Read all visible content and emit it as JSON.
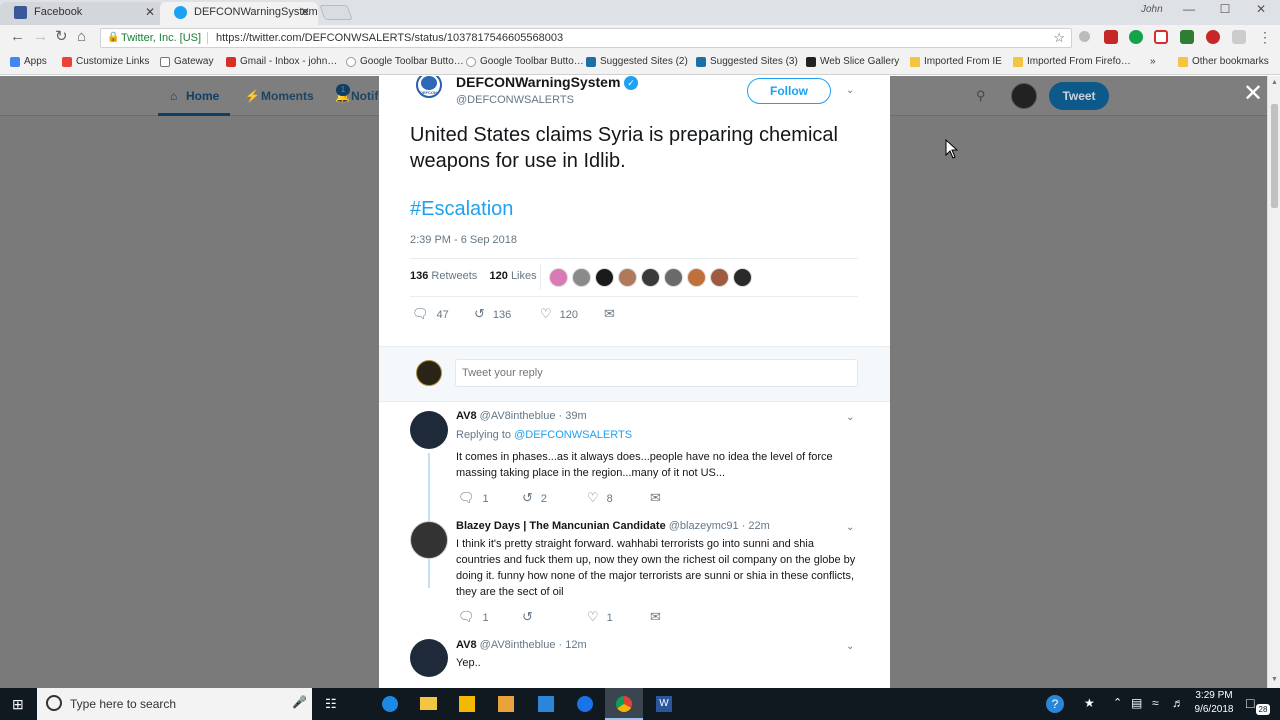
{
  "browser": {
    "tabs": [
      {
        "title": "Facebook",
        "close": "✕"
      },
      {
        "title": "DEFCONWarningSystem",
        "close": "✕"
      }
    ],
    "profile": "John",
    "window_controls": [
      "—",
      "☐",
      "✕"
    ],
    "site_identity": "Twitter, Inc. [US]",
    "url": "https://twitter.com/DEFCONWSALERTS/status/1037817546605568003",
    "bookmarks": [
      "Apps",
      "Customize Links",
      "Gateway",
      "Gmail - Inbox - john…",
      "Google Toolbar Butto…",
      "Google Toolbar Butto…",
      "Suggested Sites (2)",
      "Suggested Sites (3)",
      "Web Slice Gallery",
      "Imported From IE",
      "Imported From Firefo…",
      "»",
      "Other bookmarks"
    ]
  },
  "twitter_nav": {
    "home": "Home",
    "moments": "Moments",
    "notifications": "Notifi",
    "notif_count": "1",
    "tweet_button": "Tweet",
    "close": "✕"
  },
  "tweet": {
    "author_name": "DEFCONWarningSystem",
    "author_handle": "@DEFCONWSALERTS",
    "avatar_label": "DEFCON",
    "verified": "✓",
    "follow": "Follow",
    "text": "United States claims Syria is preparing chemical weapons for use in Idlib.",
    "hashtag": "#Escalation",
    "time": "2:39 PM - 6 Sep 2018",
    "retweets_count": "136",
    "retweets_label": "Retweets",
    "likes_count": "120",
    "likes_label": "Likes",
    "actions": {
      "replies": "47",
      "retweets": "136",
      "likes": "120"
    },
    "liker_colors": [
      "#d97ab5",
      "#8a8a8a",
      "#1a1a1a",
      "#b07a5a",
      "#3a3a3a",
      "#6a6a6a",
      "#c0703a",
      "#a05a40",
      "#2a2a2a"
    ]
  },
  "reply_box": {
    "placeholder": "Tweet your reply"
  },
  "replies": [
    {
      "name": "AV8",
      "handle": "@AV8intheblue",
      "time": "· 39m",
      "replying_prefix": "Replying to",
      "replying_to": "@DEFCONWSALERTS",
      "text": "It comes in phases...as it always does...people have no idea the level of force massing taking place in the region...many of it not US...",
      "replies": "1",
      "retweets": "2",
      "likes": "8"
    },
    {
      "name": "Blazey Days | The Mancunian Candidate",
      "handle": "@blazeymc91",
      "time": "· 22m",
      "text": "I think it's pretty straight forward. wahhabi terrorists go into sunni and shia countries and fuck them up, now they own the richest oil company on the globe by doing it. funny how none of the major terrorists are sunni or shia in these conflicts, they are the sect of oil",
      "replies": "1",
      "retweets": "",
      "likes": "1"
    },
    {
      "name": "AV8",
      "handle": "@AV8intheblue",
      "time": "· 12m",
      "text": "Yep.."
    }
  ],
  "taskbar": {
    "search_placeholder": "Type here to search",
    "time": "3:29 PM",
    "date": "9/6/2018",
    "notifications": "28"
  }
}
